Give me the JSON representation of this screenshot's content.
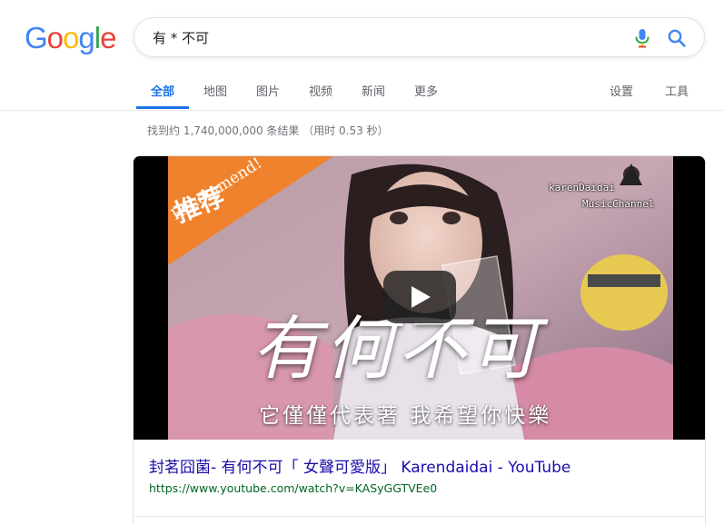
{
  "logo": {
    "letters": [
      {
        "ch": "G",
        "color": "#4285F4"
      },
      {
        "ch": "o",
        "color": "#EA4335"
      },
      {
        "ch": "o",
        "color": "#FBBC05"
      },
      {
        "ch": "g",
        "color": "#4285F4"
      },
      {
        "ch": "l",
        "color": "#34A853"
      },
      {
        "ch": "e",
        "color": "#EA4335"
      }
    ]
  },
  "search": {
    "query": "有 * 不可",
    "mic_icon": "microphone-icon",
    "search_icon": "search-icon"
  },
  "tabs": {
    "items": [
      {
        "label": "全部",
        "active": true
      },
      {
        "label": "地图"
      },
      {
        "label": "图片"
      },
      {
        "label": "视频"
      },
      {
        "label": "新闻"
      },
      {
        "label": "更多"
      }
    ],
    "settings": "设置",
    "tools": "工具"
  },
  "stats": "找到约 1,740,000,000 条结果 （用时 0.53 秒）",
  "result": {
    "thumbnail": {
      "badge_main": "推荐",
      "badge_sub": "Recommend!",
      "channel_name": "karenDaidai",
      "channel_sub": "MusicChannel",
      "overlay_title": "有何不可",
      "overlay_sub": "它僅僅代表著 我希望你快樂",
      "play_icon": "play-icon"
    },
    "title": "封茗囧菌- 有何不可「 女聲可愛版」 Karendaidai - YouTube",
    "url": "https://www.youtube.com/watch?v=KASyGGTVEe0"
  },
  "colors": {
    "accent": "#1a73e8",
    "link": "#1a0dab",
    "url_green": "#006621",
    "badge_orange": "#f0822e"
  }
}
